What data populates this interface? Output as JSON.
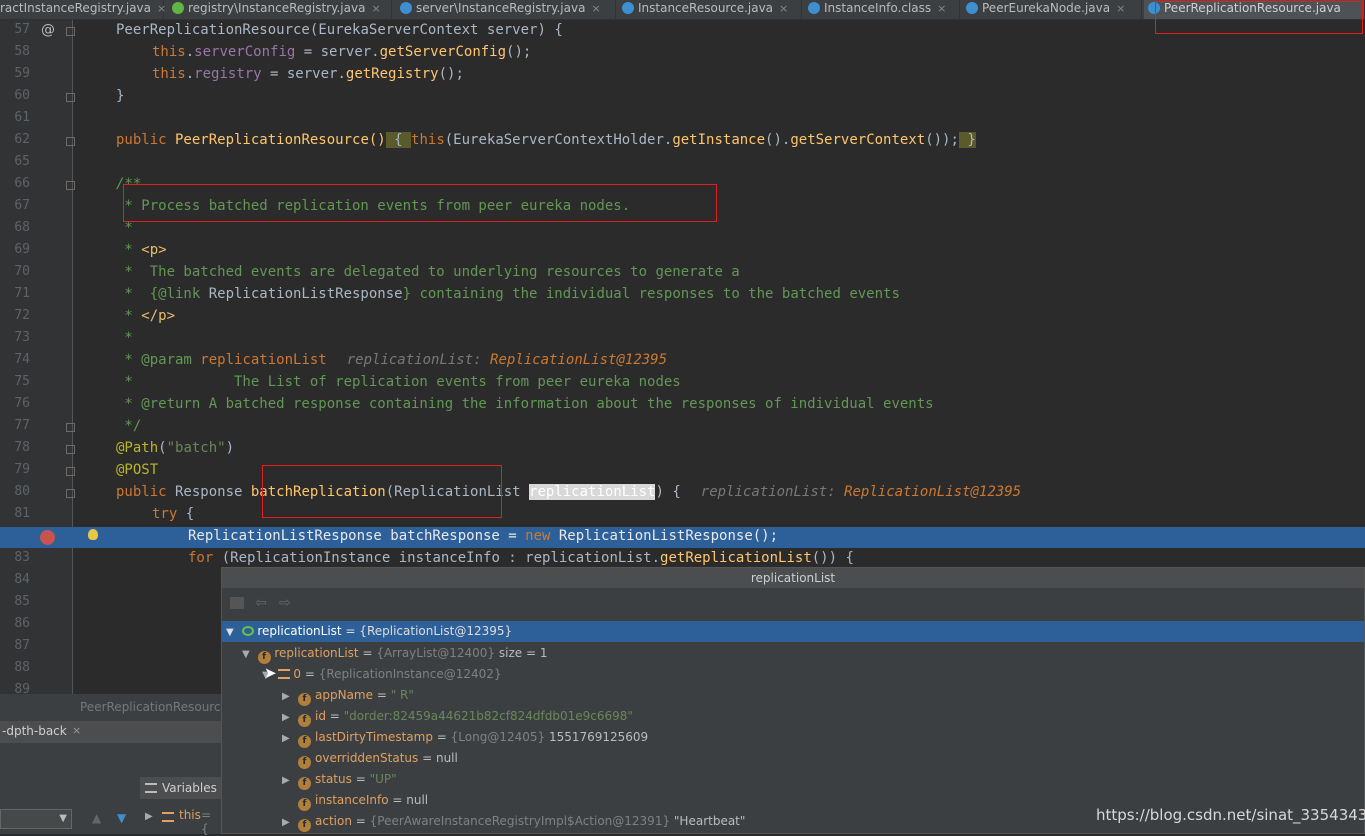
{
  "tabs": [
    {
      "label": "ractInstanceRegistry.java"
    },
    {
      "label": "registry\\InstanceRegistry.java"
    },
    {
      "label": "server\\InstanceRegistry.java"
    },
    {
      "label": "InstanceResource.java"
    },
    {
      "label": "InstanceInfo.class"
    },
    {
      "label": "PeerEurekaNode.java"
    },
    {
      "label": "PeerReplicationResource.java"
    }
  ],
  "close_glyph": "×",
  "at_glyph": "@",
  "line_numbers": [
    "57",
    "58",
    "59",
    "60",
    "61",
    "62",
    "65",
    "66",
    "67",
    "68",
    "69",
    "70",
    "71",
    "72",
    "73",
    "74",
    "75",
    "76",
    "77",
    "78",
    "79",
    "80",
    "81",
    "",
    "83",
    "84",
    "85",
    "86",
    "87",
    "88",
    "89"
  ],
  "code": {
    "l57": {
      "name": "PeerReplicationResource",
      "p1": "(",
      "type": "EurekaServerContext",
      "rest": " server) {"
    },
    "l58": {
      "this": "this",
      "dot": ".",
      "field": "serverConfig",
      "eq": " = server.",
      "call": "getServerConfig",
      "end": "();"
    },
    "l59": {
      "this": "this",
      "dot": ".",
      "field": "registry",
      "eq": " = server.",
      "call": "getRegistry",
      "end": "();"
    },
    "l60": "}",
    "l62": {
      "kw": "public",
      "name": " PeerReplicationResource()",
      "ob": " { ",
      "this": "this",
      "p": "(EurekaServerContextHolder.",
      "c1": "getInstance",
      "m": "().",
      "c2": "getServerContext",
      "e": "());",
      "cb": " }"
    },
    "l66": "/**",
    "l67": " * Process batched replication events from peer eureka nodes.",
    "l68": " *",
    "l69": {
      "pre": " * ",
      "tag": "<p>"
    },
    "l70": " *  The batched events are delegated to underlying resources to generate a",
    "l71": {
      "pre": " *  {@link ",
      "ref": "ReplicationListResponse",
      "post": "} containing the individual responses to the batched events"
    },
    "l72": {
      "pre": " * ",
      "tag": "</p>"
    },
    "l73": " *",
    "l74": {
      "pre": " * @param ",
      "param": "replicationList",
      "hint": "replicationList: ",
      "hintv": "ReplicationList@12395"
    },
    "l75": " *            The List of replication events from peer eureka nodes",
    "l76": " * @return A batched response containing the information about the responses of individual events",
    "l77": " */",
    "l78": {
      "ann": "@Path",
      "rest": "(",
      "str": "\"batch\"",
      "end": ")"
    },
    "l79": "@POST",
    "l80": {
      "kw": "public",
      "ty": " Response ",
      "fn": "batchReplication",
      "p": "(ReplicationList ",
      "param": "replicationList",
      "end": ") {",
      "hint": "replicationList: ",
      "hintv": "ReplicationList@12395"
    },
    "l81": {
      "kw": "try",
      "end": " {"
    },
    "l82": {
      "a": "ReplicationListResponse batchResponse = ",
      "kw": "new",
      "b": " ReplicationListResponse();"
    },
    "l83": {
      "kw": "for",
      "a": " (ReplicationInstance instanceInfo : replicationList.",
      "call": "getReplicationList",
      "end": "()) {"
    }
  },
  "popup": {
    "title": "replicationList",
    "root": {
      "name": "replicationList",
      "value": " = {ReplicationList@12395}"
    },
    "child": {
      "name": "replicationList",
      "eq": " = ",
      "type": "{ArrayList@12400}",
      "size": "  size = 1"
    },
    "item": {
      "name": "0",
      "eq": " = ",
      "type": "{ReplicationInstance@12402}"
    },
    "fields": [
      {
        "name": "appName",
        "eq": " = ",
        "value": "\"        R\"",
        "kind": "str",
        "expandable": true
      },
      {
        "name": "id",
        "eq": " = ",
        "value": "\"dorder:82459a44621b82cf824dfdb01e9c6698\"",
        "kind": "str",
        "expandable": true
      },
      {
        "name": "lastDirtyTimestamp",
        "eq": " = ",
        "type": "{Long@12405}",
        "value": " 1551769125609",
        "kind": "val",
        "expandable": true
      },
      {
        "name": "overriddenStatus",
        "eq": " = ",
        "value": "null",
        "kind": "val",
        "expandable": false
      },
      {
        "name": "status",
        "eq": " = ",
        "value": "\"UP\"",
        "kind": "str",
        "expandable": true
      },
      {
        "name": "instanceInfo",
        "eq": " = ",
        "value": "null",
        "kind": "val",
        "expandable": false
      },
      {
        "name": "action",
        "eq": " = ",
        "type": "{PeerAwareInstanceRegistryImpl$Action@12391}",
        "value": " \"Heartbeat\"",
        "kind": "val",
        "expandable": true
      }
    ]
  },
  "left_panel": {
    "file_tab": "PeerReplicationResourc",
    "run_tab": "-dpth-back",
    "variables_label": "Variables",
    "var_this": "this",
    "var_this_eq": " = {"
  },
  "watermark": "https://blog.csdn.net/sinat_33543436"
}
